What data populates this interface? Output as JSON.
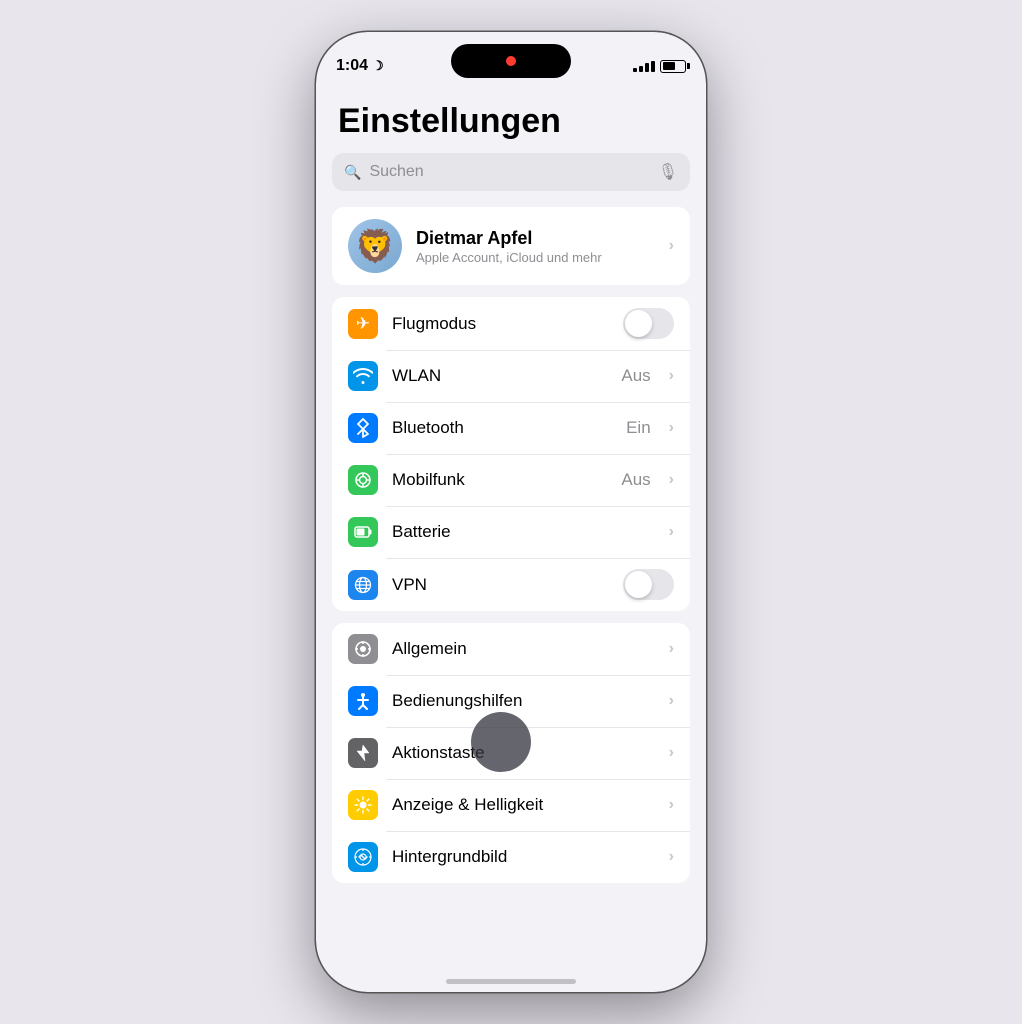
{
  "status": {
    "time": "1:04",
    "moon": "☽",
    "battery_pct": 60
  },
  "page": {
    "title": "Einstellungen",
    "search_placeholder": "Suchen"
  },
  "profile": {
    "name": "Dietmar Apfel",
    "subtitle": "Apple Account, iCloud und mehr",
    "avatar_emoji": "🦁"
  },
  "sections": [
    {
      "id": "network",
      "rows": [
        {
          "id": "flugmodus",
          "label": "Flugmodus",
          "icon": "✈",
          "icon_color": "icon-orange",
          "type": "toggle",
          "toggle_on": false
        },
        {
          "id": "wlan",
          "label": "WLAN",
          "icon": "📶",
          "icon_color": "icon-blue2",
          "type": "value",
          "value": "Aus"
        },
        {
          "id": "bluetooth",
          "label": "Bluetooth",
          "icon": "⚡",
          "icon_color": "icon-blue",
          "type": "value",
          "value": "Ein"
        },
        {
          "id": "mobilfunk",
          "label": "Mobilfunk",
          "icon": "📡",
          "icon_color": "icon-green",
          "type": "value",
          "value": "Aus"
        },
        {
          "id": "batterie",
          "label": "Batterie",
          "icon": "🔋",
          "icon_color": "icon-green",
          "type": "chevron"
        },
        {
          "id": "vpn",
          "label": "VPN",
          "icon": "🌐",
          "icon_color": "icon-globe",
          "type": "toggle",
          "toggle_on": false
        }
      ]
    },
    {
      "id": "system",
      "rows": [
        {
          "id": "allgemein",
          "label": "Allgemein",
          "icon": "⚙",
          "icon_color": "icon-gray",
          "type": "chevron"
        },
        {
          "id": "bedienungshilfen",
          "label": "Bedienungshilfen",
          "icon": "♿",
          "icon_color": "icon-blue-acc",
          "type": "chevron"
        },
        {
          "id": "aktionstaste",
          "label": "Aktionstaste",
          "icon": "✦",
          "icon_color": "icon-dark-gray",
          "type": "chevron"
        },
        {
          "id": "anzeige",
          "label": "Anzeige & Helligkeit",
          "icon": "☀",
          "icon_color": "icon-yellow",
          "type": "chevron"
        },
        {
          "id": "hintergrundbild",
          "label": "Hintergrundbild",
          "icon": "❋",
          "icon_color": "icon-blue2",
          "type": "chevron"
        }
      ]
    }
  ]
}
